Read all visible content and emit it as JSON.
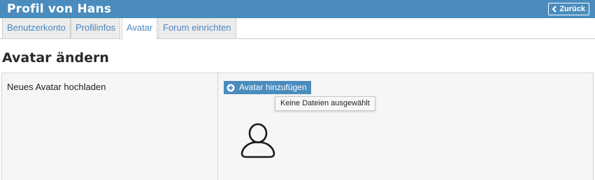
{
  "header": {
    "title": "Profil von Hans",
    "back_label": "Zurück"
  },
  "tabs": [
    {
      "label": "Benutzerkonto",
      "active": false
    },
    {
      "label": "Profilinfos",
      "active": false
    },
    {
      "label": "Avatar",
      "active": true
    },
    {
      "label": "Forum einrichten",
      "active": false
    }
  ],
  "section": {
    "title": "Avatar ändern"
  },
  "form": {
    "upload_label": "Neues Avatar hochladen",
    "add_button_label": "Avatar hinzufügen",
    "file_status": "Keine Dateien ausgewählt"
  },
  "icons": {
    "back": "chevron-left-icon",
    "add": "plus-circle-icon",
    "avatar": "user-avatar-icon"
  },
  "colors": {
    "header_bg": "#4a8cbd",
    "button_bg": "#4a8cbd",
    "tab_text": "#4a87bf"
  }
}
